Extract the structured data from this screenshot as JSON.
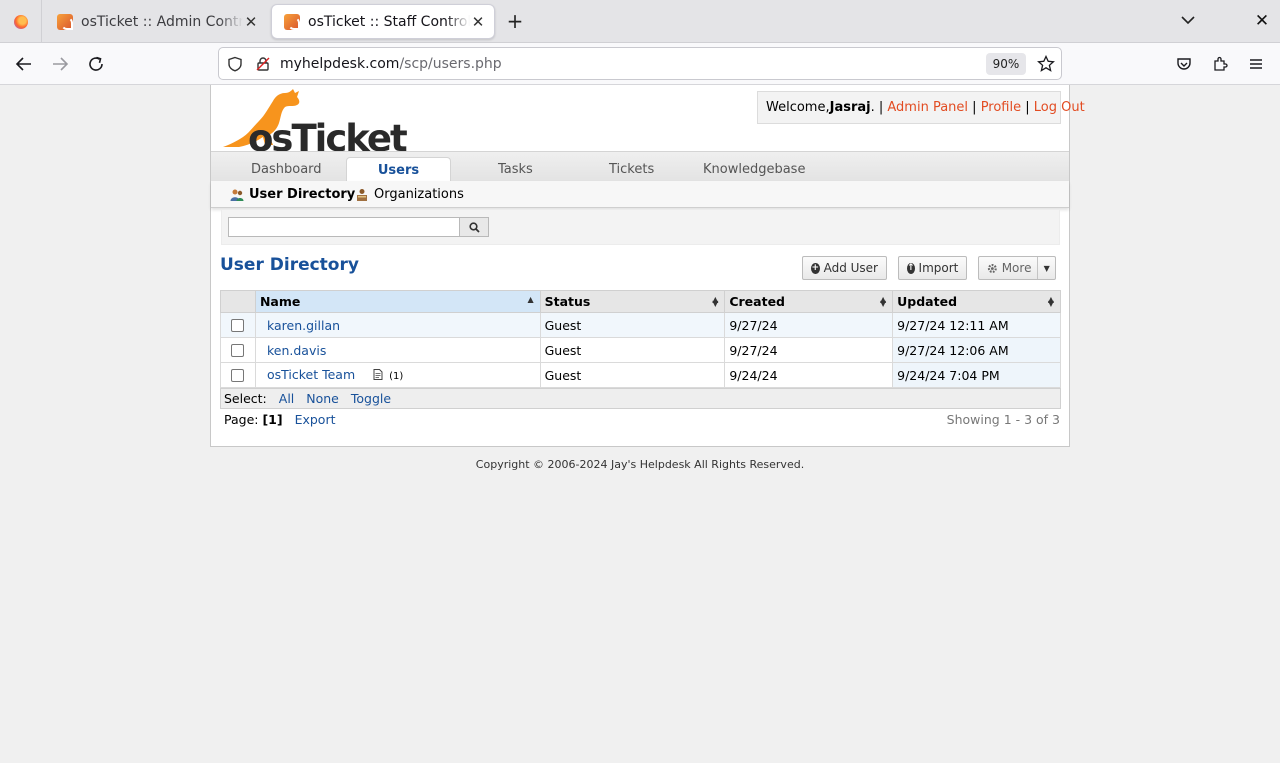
{
  "browser": {
    "tabs": [
      {
        "title": "osTicket :: Admin Control Panel",
        "active": false
      },
      {
        "title": "osTicket :: Staff Control Panel",
        "active": true
      }
    ],
    "url_host": "myhelpdesk.com",
    "url_path": "/scp/users.php",
    "zoom": "90%"
  },
  "header": {
    "logo_text": "osTicket",
    "welcome_prefix": "Welcome, ",
    "username": "Jasraj",
    "welcome_suffix": ". | ",
    "admin_panel": "Admin Panel",
    "sep1": " | ",
    "profile": "Profile",
    "sep2": " | ",
    "logout": "Log Out"
  },
  "nav": {
    "dashboard": "Dashboard",
    "users": "Users",
    "tasks": "Tasks",
    "tickets": "Tickets",
    "knowledgebase": "Knowledgebase"
  },
  "subnav": {
    "user_directory": "User Directory",
    "organizations": "Organizations"
  },
  "search": {
    "value": ""
  },
  "page": {
    "title": "User Directory",
    "add_user": "Add User",
    "import": "Import",
    "more": "More"
  },
  "table": {
    "headers": {
      "name": "Name",
      "status": "Status",
      "created": "Created",
      "updated": "Updated"
    },
    "rows": [
      {
        "name": "karen.gillan",
        "status": "Guest",
        "created": "9/27/24",
        "updated": "9/27/24 12:11 AM"
      },
      {
        "name": "ken.davis",
        "status": "Guest",
        "created": "9/27/24",
        "updated": "9/27/24 12:06 AM"
      },
      {
        "name": "osTicket Team",
        "note_count": "(1)",
        "status": "Guest",
        "created": "9/24/24",
        "updated": "9/24/24 7:04 PM"
      }
    ]
  },
  "select": {
    "label": "Select:",
    "all": "All",
    "none": "None",
    "toggle": "Toggle"
  },
  "pager": {
    "label": "Page:",
    "current": "[1]",
    "export": "Export",
    "showing": "Showing 1 - 3 of 3"
  },
  "footer": {
    "copyright": "Copyright © 2006-2024 Jay's Helpdesk All Rights Reserved."
  },
  "colors": {
    "link": "#18519a",
    "accent": "#e24c22",
    "logo_orange": "#f7941d"
  }
}
